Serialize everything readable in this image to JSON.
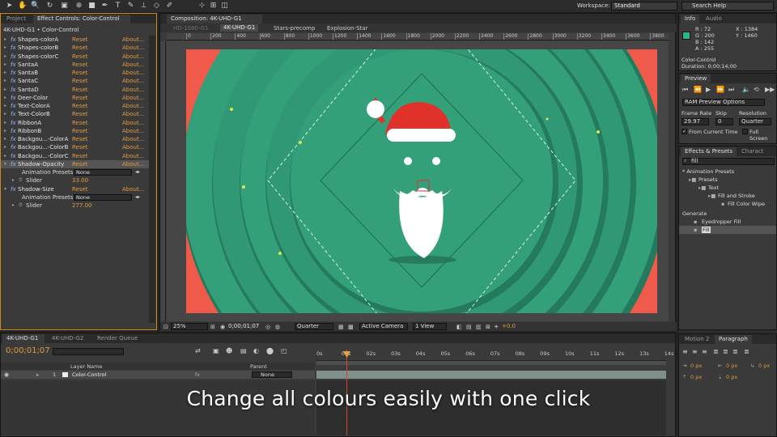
{
  "toolbar": {
    "workspace_label": "Workspace:",
    "workspace_value": "Standard",
    "search_placeholder": "Search Help"
  },
  "effect_controls": {
    "tabs": [
      "Project",
      "Effect Controls: Color-Control"
    ],
    "header": "4K-UHD-G1 • Color-Control",
    "reset_label": "Reset",
    "about_label": "About...",
    "effects": [
      "Shapes-colorA",
      "Shapes-colorB",
      "Shapes-colorC",
      "SantaA",
      "SantaB",
      "SantaC",
      "SantaD",
      "Deer-Color",
      "Text-ColorA",
      "Text-ColorB",
      "RibbonA",
      "RibbonB",
      "Backgou...-ColorA",
      "Backgou...-ColorB",
      "Backgou...-ColorC",
      "Shadow-Opacity"
    ],
    "shadow_opacity": {
      "presets_label": "Animation Presets:",
      "presets_value": "None",
      "slider_label": "Slider",
      "slider_value": "33.00"
    },
    "shadow_size": {
      "name": "Shadow-Size",
      "presets_label": "Animation Presets:",
      "presets_value": "None",
      "slider_label": "Slider",
      "slider_value": "277.00"
    }
  },
  "composition": {
    "title": "Composition: 4K-UHD-G1",
    "breadcrumbs": [
      "HD-1080-G1",
      "4K-UHD-G1",
      "Stars-precomp",
      "Explosion-Star"
    ],
    "ruler_ticks": [
      "0",
      "200",
      "400",
      "600",
      "800",
      "1000",
      "1200",
      "1400",
      "1600",
      "1800",
      "2000",
      "2200",
      "2400",
      "2600",
      "2800",
      "3000",
      "3200",
      "3400",
      "3600",
      "3800"
    ],
    "footer": {
      "zoom": "25%",
      "timecode": "0;00;01;07",
      "resolution": "Quarter",
      "camera": "Active Camera",
      "view": "1 View",
      "exposure": "+0.0"
    },
    "colors": {
      "background": "#f05a4a",
      "ring_dark": "#2c8a6a",
      "ring_light": "#34a07a",
      "hat": "#e0312b"
    }
  },
  "info": {
    "tabs": [
      "Info",
      "Audio"
    ],
    "r": "R : 72",
    "g": "G : 200",
    "b": "B : 142",
    "a": "A : 255",
    "x": "X : 1384",
    "y": "Y : 1460",
    "layer": "Color-Control",
    "duration": "Duration: 0;00;14;00",
    "swatch": "#2cb48c"
  },
  "preview": {
    "title": "Preview",
    "ram_options": "RAM Preview Options",
    "frame_rate_label": "Frame Rate",
    "skip_label": "Skip",
    "resolution_label": "Resolution",
    "frame_rate": "29.97",
    "skip": "0",
    "resolution": "Quarter",
    "from_current": "From Current Time",
    "full_screen": "Full Screen"
  },
  "effects_presets": {
    "tabs": [
      "Effects & Presets",
      "Charact"
    ],
    "search": "fill",
    "tree": [
      "* Animation Presets",
      "Presets",
      "Text",
      "Fill and Stroke",
      "Fill Color Wipe",
      "Generate",
      "Eyedropper Fill",
      "Fill"
    ]
  },
  "paragraph": {
    "tabs": [
      "Motion 2",
      "Paragraph"
    ],
    "values": [
      "0 px",
      "0 px",
      "0 px",
      "0 px",
      "0 px"
    ]
  },
  "timeline": {
    "tabs": [
      "4K-UHD-G1",
      "4K-UHD-G2",
      "Render Queue"
    ],
    "timecode": "0;00;01;07",
    "time_labels": [
      "0s",
      "01s",
      "02s",
      "03s",
      "04s",
      "05s",
      "06s",
      "07s",
      "08s",
      "09s",
      "10s",
      "11s",
      "12s",
      "13s",
      "14s"
    ],
    "col_layer_name": "Layer Name",
    "col_parent": "Parent",
    "layer1": {
      "index": "1",
      "name": "Color-Control",
      "parent": "None"
    }
  },
  "caption": "Change all colours easily with one click"
}
